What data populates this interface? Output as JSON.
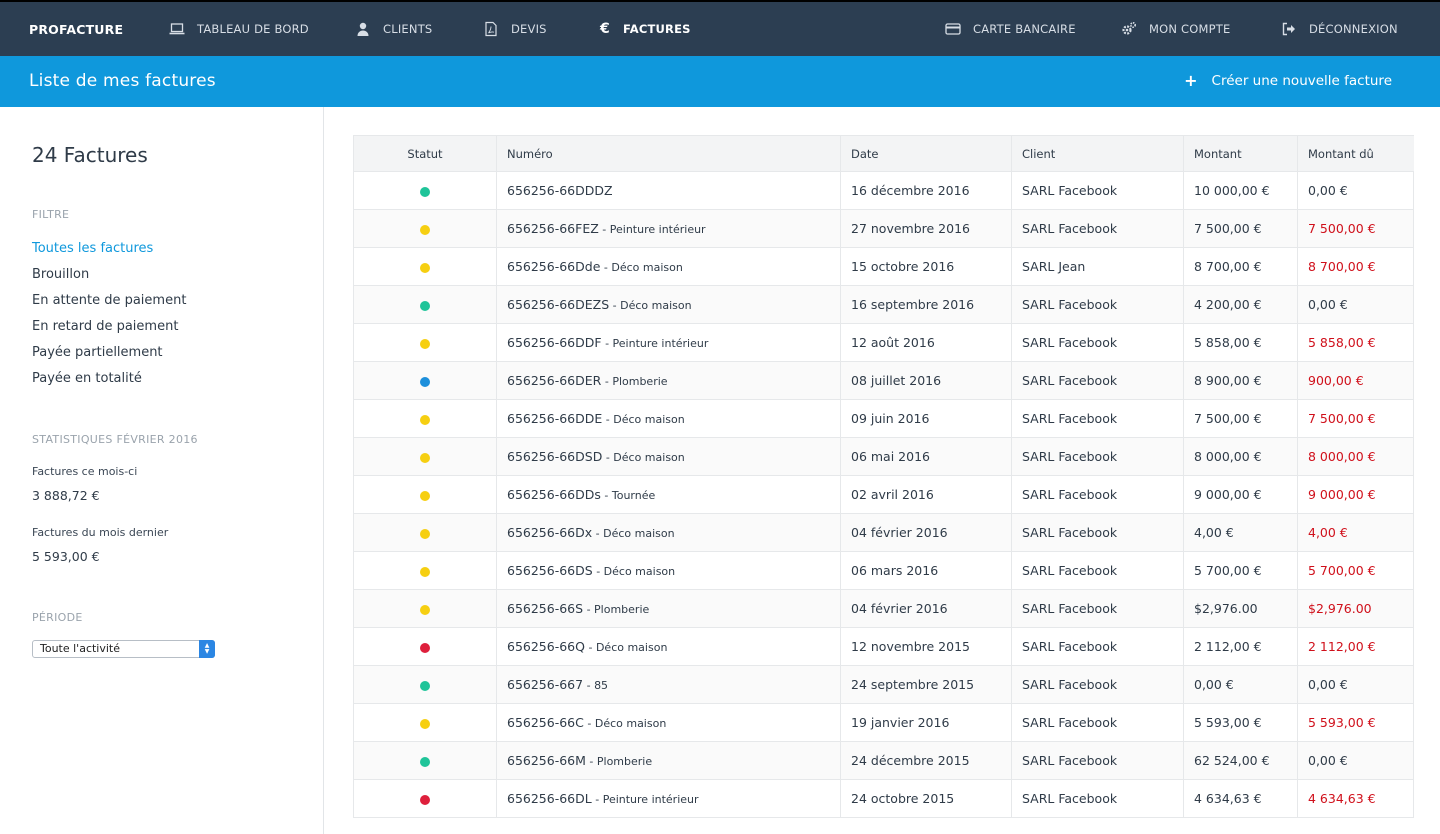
{
  "nav": {
    "brand": "PROFACTURE",
    "items": [
      {
        "label": "TABLEAU DE BORD",
        "icon": "laptop-icon"
      },
      {
        "label": "CLIENTS",
        "icon": "user-icon"
      },
      {
        "label": "DEVIS",
        "icon": "pdf-file-icon"
      },
      {
        "label": "FACTURES",
        "icon": "euro-icon"
      }
    ],
    "right_items": [
      {
        "label": "CARTE BANCAIRE",
        "icon": "credit-card-icon"
      },
      {
        "label": "MON COMPTE",
        "icon": "gears-icon"
      },
      {
        "label": "DÉCONNEXION",
        "icon": "sign-out-icon"
      }
    ]
  },
  "header": {
    "title": "Liste de mes factures",
    "create_label": "Créer une nouvelle facture",
    "create_icon": "plus-icon"
  },
  "sidebar": {
    "count": "24 Factures",
    "filter_title": "FILTRE",
    "filters": [
      "Toutes les factures",
      "Brouillon",
      "En attente de paiement",
      "En retard de paiement",
      "Payée partiellement",
      "Payée en totalité"
    ],
    "stats_title": "STATISTIQUES FÉVRIER 2016",
    "stats": [
      {
        "label": "Factures ce mois-ci",
        "value": "3 888,72 €"
      },
      {
        "label": "Factures du mois dernier",
        "value": "5 593,00 €"
      }
    ],
    "period_title": "PÉRIODE",
    "period_value": "Toute l'activité"
  },
  "colors": {
    "green": "#1fc499",
    "yellow": "#f6cf11",
    "blue": "#1d8fdb",
    "red": "#de1f3c",
    "accent": "#0f98dc",
    "nav_bg": "#2c3e52"
  },
  "table": {
    "headers": [
      "Statut",
      "Numéro",
      "Date",
      "Client",
      "Montant",
      "Montant dû"
    ],
    "rows": [
      {
        "status": "green",
        "num": "656256-66DDDZ",
        "desc": "",
        "date": "16 décembre 2016",
        "client": "SARL Facebook",
        "amount": "10 000,00 €",
        "due": "0,00 €"
      },
      {
        "status": "yellow",
        "num": "656256-66FEZ",
        "desc": "Peinture intérieur",
        "date": "27 novembre 2016",
        "client": "SARL Facebook",
        "amount": "7 500,00 €",
        "due": "7 500,00 €"
      },
      {
        "status": "yellow",
        "num": "656256-66Dde",
        "desc": "Déco maison",
        "date": "15 octobre 2016",
        "client": "SARL Jean",
        "amount": "8 700,00 €",
        "due": "8 700,00 €"
      },
      {
        "status": "green",
        "num": "656256-66DEZS",
        "desc": "Déco maison",
        "date": "16 septembre 2016",
        "client": "SARL Facebook",
        "amount": "4 200,00 €",
        "due": "0,00 €"
      },
      {
        "status": "yellow",
        "num": "656256-66DDF",
        "desc": "Peinture intérieur",
        "date": "12 août 2016",
        "client": "SARL Facebook",
        "amount": "5 858,00 €",
        "due": "5 858,00 €"
      },
      {
        "status": "blue",
        "num": "656256-66DER",
        "desc": "Plomberie",
        "date": "08 juillet 2016",
        "client": "SARL Facebook",
        "amount": "8 900,00 €",
        "due": "900,00 €"
      },
      {
        "status": "yellow",
        "num": "656256-66DDE",
        "desc": "Déco maison",
        "date": "09 juin 2016",
        "client": "SARL Facebook",
        "amount": "7 500,00 €",
        "due": "7 500,00 €"
      },
      {
        "status": "yellow",
        "num": "656256-66DSD",
        "desc": "Déco maison",
        "date": "06 mai 2016",
        "client": "SARL Facebook",
        "amount": "8 000,00 €",
        "due": "8 000,00 €"
      },
      {
        "status": "yellow",
        "num": "656256-66DDs",
        "desc": "Tournée",
        "date": "02 avril 2016",
        "client": "SARL Facebook",
        "amount": "9 000,00 €",
        "due": "9 000,00 €"
      },
      {
        "status": "yellow",
        "num": "656256-66Dx",
        "desc": "Déco maison",
        "date": "04 février 2016",
        "client": "SARL Facebook",
        "amount": "4,00 €",
        "due": "4,00 €"
      },
      {
        "status": "yellow",
        "num": "656256-66DS",
        "desc": "Déco maison",
        "date": "06 mars 2016",
        "client": "SARL Facebook",
        "amount": "5 700,00 €",
        "due": "5 700,00 €"
      },
      {
        "status": "yellow",
        "num": "656256-66S",
        "desc": "Plomberie",
        "date": "04 février 2016",
        "client": "SARL Facebook",
        "amount": "$2,976.00",
        "due": "$2,976.00"
      },
      {
        "status": "red",
        "num": "656256-66Q",
        "desc": "Déco maison",
        "date": "12 novembre 2015",
        "client": "SARL Facebook",
        "amount": "2 112,00 €",
        "due": "2 112,00 €"
      },
      {
        "status": "green",
        "num": "656256-667",
        "desc": "85",
        "date": "24 septembre 2015",
        "client": "SARL Facebook",
        "amount": "0,00 €",
        "due": "0,00 €"
      },
      {
        "status": "yellow",
        "num": "656256-66C",
        "desc": "Déco maison",
        "date": "19 janvier 2016",
        "client": "SARL Facebook",
        "amount": "5 593,00 €",
        "due": "5 593,00 €"
      },
      {
        "status": "green",
        "num": "656256-66M",
        "desc": "Plomberie",
        "date": "24 décembre 2015",
        "client": "SARL Facebook",
        "amount": "62 524,00 €",
        "due": "0,00 €"
      },
      {
        "status": "red",
        "num": "656256-66DL",
        "desc": "Peinture intérieur",
        "date": "24 octobre 2015",
        "client": "SARL Facebook",
        "amount": "4 634,63 €",
        "due": "4 634,63 €"
      }
    ]
  }
}
